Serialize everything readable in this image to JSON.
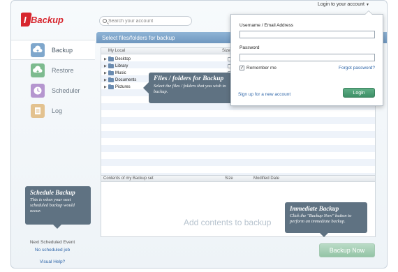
{
  "header": {
    "logo_text": "IBackup",
    "search_placeholder": "Search your account",
    "login_menu_label": "Login to your account"
  },
  "sidebar": {
    "items": [
      {
        "label": "Backup",
        "active": true
      },
      {
        "label": "Restore",
        "active": false
      },
      {
        "label": "Scheduler",
        "active": false
      },
      {
        "label": "Log",
        "active": false
      }
    ],
    "schedule_tip": {
      "title": "Schedule Backup",
      "text": "This is when your next scheduled backup would occur."
    },
    "next_scheduled_label": "Next Scheduled Event",
    "no_job_label": "No scheduled job",
    "visual_help_label": "Visual Help?"
  },
  "main": {
    "panel_title": "Select files/folders for backup",
    "file_columns": {
      "name": "My Local",
      "size": "Size"
    },
    "tree": [
      "Desktop",
      "Library",
      "Music",
      "Documents",
      "Pictures"
    ],
    "files_tip": {
      "title": "Files / folders for Backup",
      "text": "Select the files / folders that you wish to backup."
    },
    "backup_set_columns": {
      "name": "Contents of my Backup set",
      "size": "Size",
      "modified": "Modified Date"
    },
    "add_contents_text": "Add contents to backup",
    "immediate_tip": {
      "title": "Immediate Backup",
      "text": "Click the \"Backup Now\" button to perform an immediate backup."
    },
    "backup_now_label": "Backup Now"
  },
  "login": {
    "username_label": "Username / Email Address",
    "password_label": "Password",
    "remember_label": "Remember me",
    "remember_checked": true,
    "forgot_label": "Forgot password?",
    "signup_label": "Sign up for a new account",
    "login_button": "Login"
  },
  "colors": {
    "accent": "#2f66a8",
    "tip_bg": "#5f7282",
    "login_green": "#4a9e74",
    "backup_now_green": "#a8d2b8"
  }
}
